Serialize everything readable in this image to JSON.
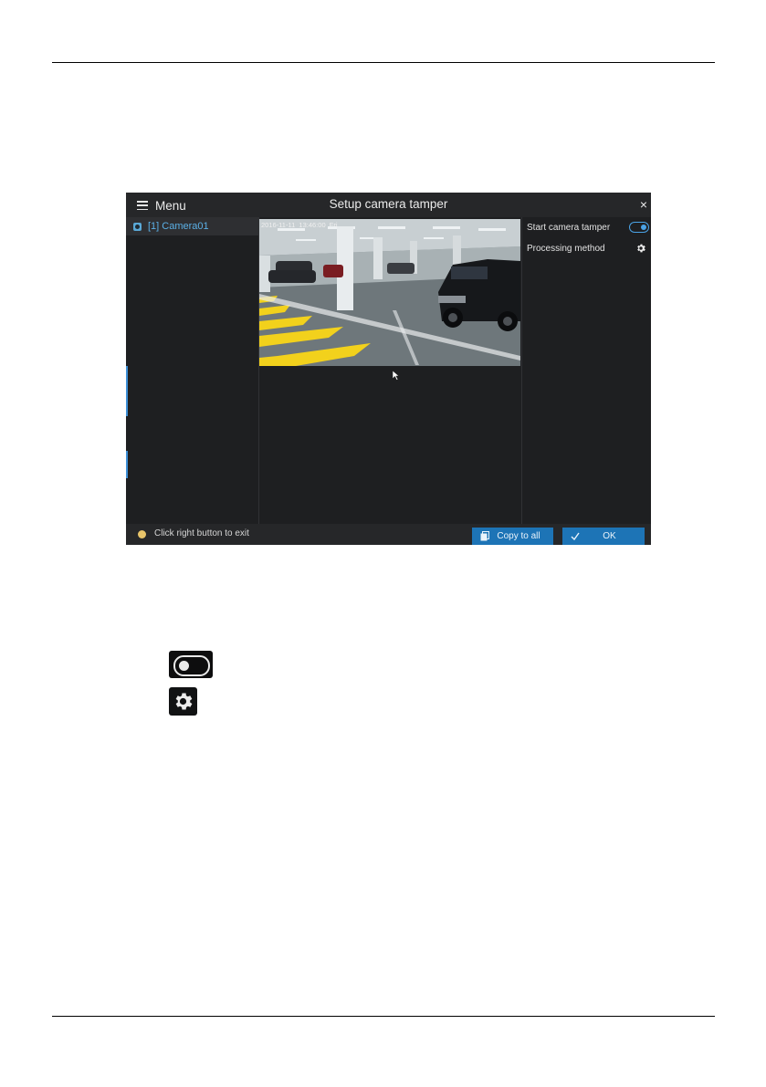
{
  "window": {
    "menu_label": "Menu",
    "title": "Setup camera tamper",
    "close_glyph": "×"
  },
  "camera_list": [
    {
      "label": "[1]  Camera01",
      "selected": true,
      "icon": "camera-icon"
    }
  ],
  "preview": {
    "osd_timestamp": "2016-11-11  13:46:00  Fri"
  },
  "settings": {
    "start_camera_tamper": {
      "label": "Start camera tamper",
      "enabled": true,
      "icon": "toggle-on-icon"
    },
    "processing_method": {
      "label": "Processing method",
      "icon": "gear-icon"
    }
  },
  "footer": {
    "hint": "Click right button to exit",
    "hint_icon": "mouse-icon",
    "copy_button": "Copy to all",
    "copy_icon": "copy-icon",
    "ok_button": "OK",
    "ok_icon": "check-icon"
  },
  "legend_icons": [
    {
      "name": "toggle-off-icon"
    },
    {
      "name": "gear-icon"
    }
  ],
  "colors": {
    "accent": "#1d74b6",
    "selected_text": "#5bb0e6",
    "background": "#1e1f21"
  }
}
